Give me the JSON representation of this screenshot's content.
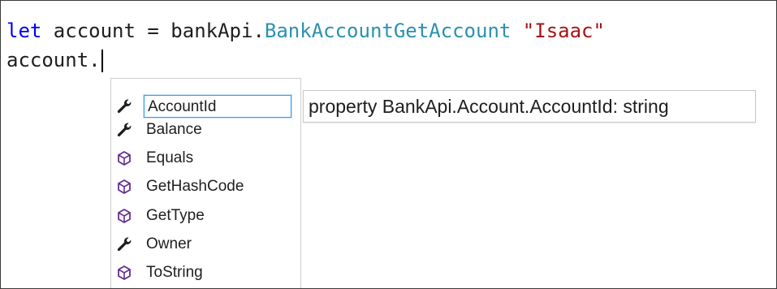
{
  "editor": {
    "line1": {
      "keyword": "let",
      "before_type": " account = bankApi.",
      "type": "BankAccountGetAccount",
      "space": " ",
      "string": "\"Isaac\""
    },
    "line2": {
      "text": "account."
    }
  },
  "completion": {
    "items": [
      {
        "label": "AccountId",
        "icon": "wrench-icon",
        "kind": "property",
        "selected": true
      },
      {
        "label": "Balance",
        "icon": "wrench-icon",
        "kind": "property",
        "selected": false
      },
      {
        "label": "Equals",
        "icon": "method-cube-icon",
        "kind": "method",
        "selected": false
      },
      {
        "label": "GetHashCode",
        "icon": "method-cube-icon",
        "kind": "method",
        "selected": false
      },
      {
        "label": "GetType",
        "icon": "method-cube-icon",
        "kind": "method",
        "selected": false
      },
      {
        "label": "Owner",
        "icon": "wrench-icon",
        "kind": "property",
        "selected": false
      },
      {
        "label": "ToString",
        "icon": "method-cube-icon",
        "kind": "method",
        "selected": false
      }
    ]
  },
  "tooltip": {
    "text": "property BankApi.Account.AccountId: string"
  },
  "colors": {
    "keyword": "#0000ff",
    "type": "#2b91af",
    "string": "#a31515",
    "selection_border": "#3399ff",
    "method_icon": "#652d90"
  }
}
